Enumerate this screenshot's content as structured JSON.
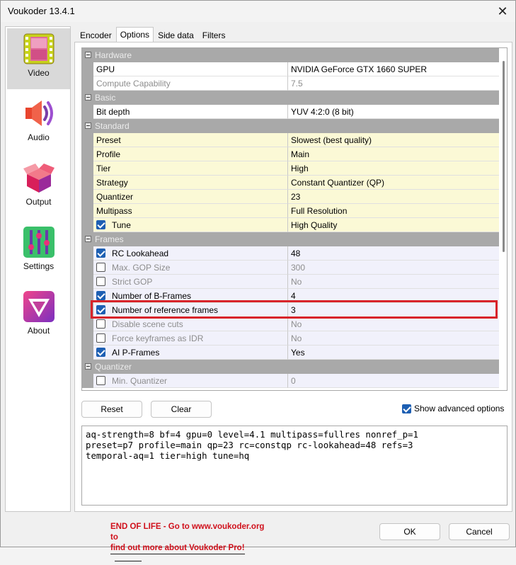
{
  "window": {
    "title": "Voukoder 13.4.1"
  },
  "nav": [
    {
      "label": "Video",
      "icon": "film-strip-icon",
      "active": true
    },
    {
      "label": "Audio",
      "icon": "speaker-icon",
      "active": false
    },
    {
      "label": "Output",
      "icon": "box-icon",
      "active": false
    },
    {
      "label": "Settings",
      "icon": "sliders-icon",
      "active": false
    },
    {
      "label": "About",
      "icon": "voukoder-logo-icon",
      "active": false
    }
  ],
  "tabs": [
    "Encoder",
    "Options",
    "Side data",
    "Filters"
  ],
  "grid": {
    "rows": [
      {
        "type": "cat",
        "name": "Hardware"
      },
      {
        "type": "prop",
        "style": "white",
        "name": "GPU",
        "value": "NVIDIA GeForce GTX 1660 SUPER"
      },
      {
        "type": "prop",
        "style": "white",
        "disabled": true,
        "name": "Compute Capability",
        "value": "7.5"
      },
      {
        "type": "cat",
        "name": "Basic"
      },
      {
        "type": "prop",
        "style": "white",
        "name": "Bit depth",
        "value": "YUV 4:2:0 (8 bit)"
      },
      {
        "type": "cat",
        "name": "Standard"
      },
      {
        "type": "prop",
        "style": "yellow",
        "name": "Preset",
        "value": "Slowest (best quality)"
      },
      {
        "type": "prop",
        "style": "yellow",
        "name": "Profile",
        "value": "Main"
      },
      {
        "type": "prop",
        "style": "yellow",
        "name": "Tier",
        "value": "High"
      },
      {
        "type": "prop",
        "style": "yellow",
        "name": "Strategy",
        "value": "Constant Quantizer (QP)"
      },
      {
        "type": "prop",
        "style": "yellow",
        "name": "Quantizer",
        "value": "23"
      },
      {
        "type": "prop",
        "style": "yellow",
        "name": "Multipass",
        "value": "Full Resolution"
      },
      {
        "type": "prop",
        "style": "yellow",
        "checkbox": true,
        "checked": true,
        "name": "Tune",
        "value": "High Quality"
      },
      {
        "type": "cat",
        "name": "Frames"
      },
      {
        "type": "prop",
        "style": "lav",
        "checkbox": true,
        "checked": true,
        "name": "RC Lookahead",
        "value": "48"
      },
      {
        "type": "prop",
        "style": "lav",
        "checkbox": true,
        "checked": false,
        "disabled": true,
        "name": "Max. GOP Size",
        "value": "300"
      },
      {
        "type": "prop",
        "style": "lav",
        "checkbox": true,
        "checked": false,
        "disabled": true,
        "name": "Strict GOP",
        "value": "No"
      },
      {
        "type": "prop",
        "style": "lav",
        "checkbox": true,
        "checked": true,
        "name": "Number of B-Frames",
        "value": "4"
      },
      {
        "type": "prop",
        "style": "lav",
        "checkbox": true,
        "checked": true,
        "name": "Number of reference frames",
        "value": "3"
      },
      {
        "type": "prop",
        "style": "lav",
        "checkbox": true,
        "checked": false,
        "disabled": true,
        "name": "Disable scene cuts",
        "value": "No"
      },
      {
        "type": "prop",
        "style": "lav",
        "checkbox": true,
        "checked": false,
        "disabled": true,
        "name": "Force keyframes as IDR",
        "value": "No"
      },
      {
        "type": "prop",
        "style": "lav",
        "checkbox": true,
        "checked": true,
        "name": "AI P-Frames",
        "value": "Yes"
      },
      {
        "type": "cat",
        "name": "Quantizer"
      },
      {
        "type": "prop",
        "style": "lav",
        "checkbox": true,
        "checked": false,
        "disabled": true,
        "name": "Min. Quantizer",
        "value": "0"
      }
    ]
  },
  "buttons": {
    "reset": "Reset",
    "clear": "Clear",
    "ok": "OK",
    "cancel": "Cancel"
  },
  "advanced": {
    "label": "Show advanced options",
    "checked": true
  },
  "command": "aq-strength=8 bf=4 gpu=0 level=4.1 multipass=fullres nonref_p=1\npreset=p7 profile=main qp=23 rc=constqp rc-lookahead=48 refs=3\ntemporal-aq=1 tier=high tune=hq",
  "notice": {
    "line1": "END OF LIFE - Go to www.voukoder.org to",
    "line2": "find out more about Voukoder Pro!"
  },
  "colors": {
    "highlight": "#d8242a",
    "checkbox": "#1d5fb3",
    "notice": "#d0101b"
  }
}
